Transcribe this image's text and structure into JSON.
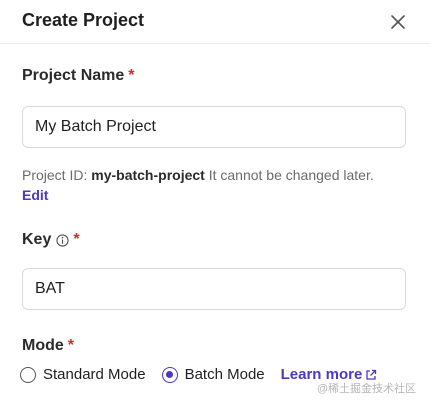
{
  "dialog": {
    "title": "Create Project"
  },
  "project_name": {
    "label": "Project Name",
    "required_mark": "*",
    "value": "My Batch Project"
  },
  "project_id_hint": {
    "prefix": "Project ID:",
    "id": "my-batch-project",
    "suffix": "It cannot be changed later.",
    "edit_label": "Edit"
  },
  "key": {
    "label": "Key",
    "required_mark": "*",
    "value": "BAT"
  },
  "mode": {
    "label": "Mode",
    "required_mark": "*",
    "options": [
      {
        "label": "Standard Mode",
        "selected": false
      },
      {
        "label": "Batch Mode",
        "selected": true
      }
    ],
    "learn_more_label": "Learn more"
  },
  "watermark": "@稀土掘金技术社区",
  "colors": {
    "accent": "#4a3ac2",
    "required": "#d42a2a",
    "border": "#d9d9d9",
    "hint_text": "#6b6b6b"
  }
}
